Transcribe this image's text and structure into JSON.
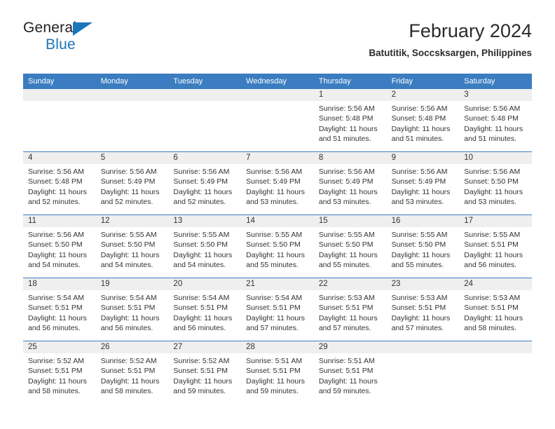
{
  "brand": {
    "name_top": "General",
    "name_bottom": "Blue",
    "accent_color": "#1b75bb"
  },
  "header": {
    "title": "February 2024",
    "subtitle": "Batutitik, Soccsksargen, Philippines"
  },
  "calendar": {
    "header_color": "#3b7dc0",
    "daynumber_band_color": "#efefef",
    "weekdays": [
      "Sunday",
      "Monday",
      "Tuesday",
      "Wednesday",
      "Thursday",
      "Friday",
      "Saturday"
    ],
    "labels": {
      "sunrise": "Sunrise:",
      "sunset": "Sunset:",
      "daylight": "Daylight:"
    },
    "weeks": [
      [
        {
          "empty": true
        },
        {
          "empty": true
        },
        {
          "empty": true
        },
        {
          "empty": true
        },
        {
          "day": "1",
          "sunrise": "Sunrise: 5:56 AM",
          "sunset": "Sunset: 5:48 PM",
          "daylight1": "Daylight: 11 hours",
          "daylight2": "and 51 minutes."
        },
        {
          "day": "2",
          "sunrise": "Sunrise: 5:56 AM",
          "sunset": "Sunset: 5:48 PM",
          "daylight1": "Daylight: 11 hours",
          "daylight2": "and 51 minutes."
        },
        {
          "day": "3",
          "sunrise": "Sunrise: 5:56 AM",
          "sunset": "Sunset: 5:48 PM",
          "daylight1": "Daylight: 11 hours",
          "daylight2": "and 51 minutes."
        }
      ],
      [
        {
          "day": "4",
          "sunrise": "Sunrise: 5:56 AM",
          "sunset": "Sunset: 5:48 PM",
          "daylight1": "Daylight: 11 hours",
          "daylight2": "and 52 minutes."
        },
        {
          "day": "5",
          "sunrise": "Sunrise: 5:56 AM",
          "sunset": "Sunset: 5:49 PM",
          "daylight1": "Daylight: 11 hours",
          "daylight2": "and 52 minutes."
        },
        {
          "day": "6",
          "sunrise": "Sunrise: 5:56 AM",
          "sunset": "Sunset: 5:49 PM",
          "daylight1": "Daylight: 11 hours",
          "daylight2": "and 52 minutes."
        },
        {
          "day": "7",
          "sunrise": "Sunrise: 5:56 AM",
          "sunset": "Sunset: 5:49 PM",
          "daylight1": "Daylight: 11 hours",
          "daylight2": "and 53 minutes."
        },
        {
          "day": "8",
          "sunrise": "Sunrise: 5:56 AM",
          "sunset": "Sunset: 5:49 PM",
          "daylight1": "Daylight: 11 hours",
          "daylight2": "and 53 minutes."
        },
        {
          "day": "9",
          "sunrise": "Sunrise: 5:56 AM",
          "sunset": "Sunset: 5:49 PM",
          "daylight1": "Daylight: 11 hours",
          "daylight2": "and 53 minutes."
        },
        {
          "day": "10",
          "sunrise": "Sunrise: 5:56 AM",
          "sunset": "Sunset: 5:50 PM",
          "daylight1": "Daylight: 11 hours",
          "daylight2": "and 53 minutes."
        }
      ],
      [
        {
          "day": "11",
          "sunrise": "Sunrise: 5:56 AM",
          "sunset": "Sunset: 5:50 PM",
          "daylight1": "Daylight: 11 hours",
          "daylight2": "and 54 minutes."
        },
        {
          "day": "12",
          "sunrise": "Sunrise: 5:55 AM",
          "sunset": "Sunset: 5:50 PM",
          "daylight1": "Daylight: 11 hours",
          "daylight2": "and 54 minutes."
        },
        {
          "day": "13",
          "sunrise": "Sunrise: 5:55 AM",
          "sunset": "Sunset: 5:50 PM",
          "daylight1": "Daylight: 11 hours",
          "daylight2": "and 54 minutes."
        },
        {
          "day": "14",
          "sunrise": "Sunrise: 5:55 AM",
          "sunset": "Sunset: 5:50 PM",
          "daylight1": "Daylight: 11 hours",
          "daylight2": "and 55 minutes."
        },
        {
          "day": "15",
          "sunrise": "Sunrise: 5:55 AM",
          "sunset": "Sunset: 5:50 PM",
          "daylight1": "Daylight: 11 hours",
          "daylight2": "and 55 minutes."
        },
        {
          "day": "16",
          "sunrise": "Sunrise: 5:55 AM",
          "sunset": "Sunset: 5:50 PM",
          "daylight1": "Daylight: 11 hours",
          "daylight2": "and 55 minutes."
        },
        {
          "day": "17",
          "sunrise": "Sunrise: 5:55 AM",
          "sunset": "Sunset: 5:51 PM",
          "daylight1": "Daylight: 11 hours",
          "daylight2": "and 56 minutes."
        }
      ],
      [
        {
          "day": "18",
          "sunrise": "Sunrise: 5:54 AM",
          "sunset": "Sunset: 5:51 PM",
          "daylight1": "Daylight: 11 hours",
          "daylight2": "and 56 minutes."
        },
        {
          "day": "19",
          "sunrise": "Sunrise: 5:54 AM",
          "sunset": "Sunset: 5:51 PM",
          "daylight1": "Daylight: 11 hours",
          "daylight2": "and 56 minutes."
        },
        {
          "day": "20",
          "sunrise": "Sunrise: 5:54 AM",
          "sunset": "Sunset: 5:51 PM",
          "daylight1": "Daylight: 11 hours",
          "daylight2": "and 56 minutes."
        },
        {
          "day": "21",
          "sunrise": "Sunrise: 5:54 AM",
          "sunset": "Sunset: 5:51 PM",
          "daylight1": "Daylight: 11 hours",
          "daylight2": "and 57 minutes."
        },
        {
          "day": "22",
          "sunrise": "Sunrise: 5:53 AM",
          "sunset": "Sunset: 5:51 PM",
          "daylight1": "Daylight: 11 hours",
          "daylight2": "and 57 minutes."
        },
        {
          "day": "23",
          "sunrise": "Sunrise: 5:53 AM",
          "sunset": "Sunset: 5:51 PM",
          "daylight1": "Daylight: 11 hours",
          "daylight2": "and 57 minutes."
        },
        {
          "day": "24",
          "sunrise": "Sunrise: 5:53 AM",
          "sunset": "Sunset: 5:51 PM",
          "daylight1": "Daylight: 11 hours",
          "daylight2": "and 58 minutes."
        }
      ],
      [
        {
          "day": "25",
          "sunrise": "Sunrise: 5:52 AM",
          "sunset": "Sunset: 5:51 PM",
          "daylight1": "Daylight: 11 hours",
          "daylight2": "and 58 minutes."
        },
        {
          "day": "26",
          "sunrise": "Sunrise: 5:52 AM",
          "sunset": "Sunset: 5:51 PM",
          "daylight1": "Daylight: 11 hours",
          "daylight2": "and 58 minutes."
        },
        {
          "day": "27",
          "sunrise": "Sunrise: 5:52 AM",
          "sunset": "Sunset: 5:51 PM",
          "daylight1": "Daylight: 11 hours",
          "daylight2": "and 59 minutes."
        },
        {
          "day": "28",
          "sunrise": "Sunrise: 5:51 AM",
          "sunset": "Sunset: 5:51 PM",
          "daylight1": "Daylight: 11 hours",
          "daylight2": "and 59 minutes."
        },
        {
          "day": "29",
          "sunrise": "Sunrise: 5:51 AM",
          "sunset": "Sunset: 5:51 PM",
          "daylight1": "Daylight: 11 hours",
          "daylight2": "and 59 minutes."
        },
        {
          "empty": true
        },
        {
          "empty": true
        }
      ]
    ]
  }
}
